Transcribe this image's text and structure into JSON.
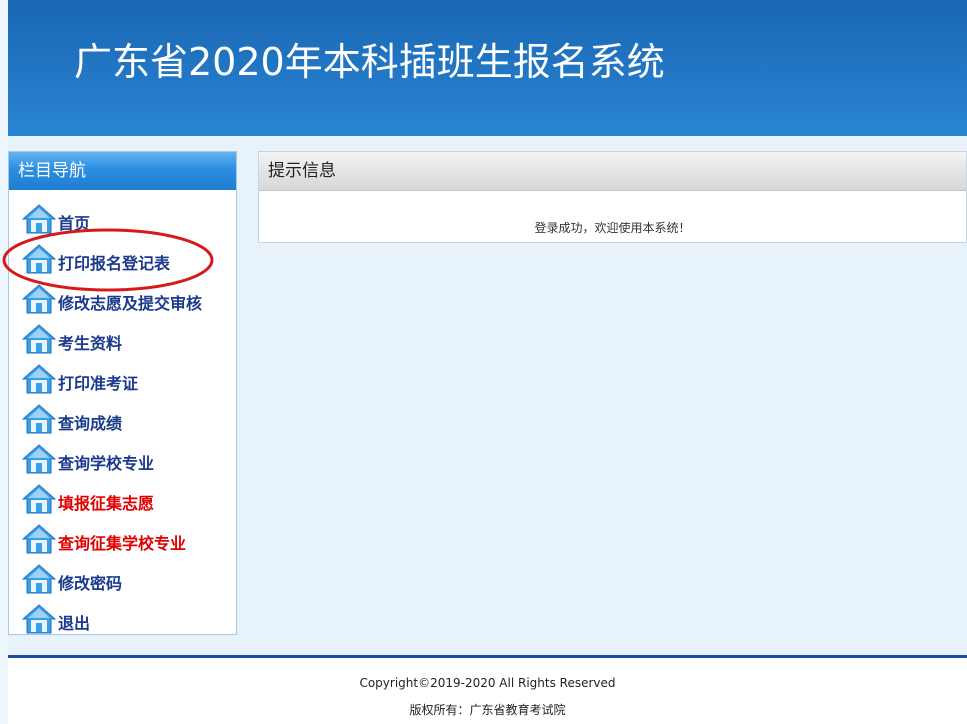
{
  "header": {
    "title": "广东省2020年本科插班生报名系统"
  },
  "sidebar": {
    "title": "栏目导航",
    "items": [
      {
        "label": "首页",
        "icon": "home-icon"
      },
      {
        "label": "打印报名登记表",
        "icon": "home-icon"
      },
      {
        "label": "修改志愿及提交审核",
        "icon": "home-icon"
      },
      {
        "label": "考生资料",
        "icon": "home-icon"
      },
      {
        "label": "打印准考证",
        "icon": "home-icon"
      },
      {
        "label": "查询成绩",
        "icon": "home-icon"
      },
      {
        "label": "查询学校专业",
        "icon": "home-icon"
      },
      {
        "label": "填报征集志愿",
        "icon": "home-icon",
        "color": "#e00000"
      },
      {
        "label": "查询征集学校专业",
        "icon": "home-icon",
        "color": "#e00000"
      },
      {
        "label": "修改密码",
        "icon": "home-icon"
      },
      {
        "label": "退出",
        "icon": "home-icon"
      }
    ]
  },
  "main": {
    "panel_title": "提示信息",
    "message": "登录成功，欢迎使用本系统！"
  },
  "footer": {
    "copyright": "Copyright©2019-2020 All Rights Reserved",
    "owner": "版权所有：广东省教育考试院"
  },
  "colors": {
    "header_blue": "#2277c4",
    "nav_text": "#1b3a8c",
    "nav_alert": "#e00000",
    "annotation": "#d61a1a"
  }
}
